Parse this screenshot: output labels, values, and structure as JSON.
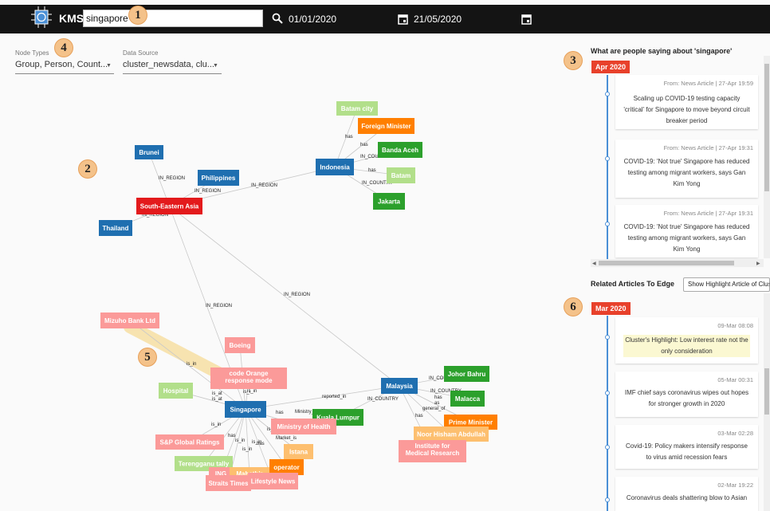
{
  "app": {
    "name": "KMS"
  },
  "header": {
    "search_value": "singapore",
    "date_from": "01/01/2020",
    "date_to": "21/05/2020"
  },
  "badges": [
    "1",
    "2",
    "3",
    "4",
    "5",
    "6"
  ],
  "filters": {
    "node_types_label": "Node Types",
    "node_types_value": "Group, Person, Count...",
    "data_source_label": "Data Source",
    "data_source_value": "cluster_newsdata, clu..."
  },
  "graph": {
    "nodes": [
      {
        "id": "brunei",
        "label": "Brunei",
        "color": "#1f6fb0"
      },
      {
        "id": "philippines",
        "label": "Philippines",
        "color": "#1f6fb0"
      },
      {
        "id": "sea",
        "label": "South-Eastern Asia",
        "color": "#e31a1c"
      },
      {
        "id": "thailand",
        "label": "Thailand",
        "color": "#1f6fb0"
      },
      {
        "id": "indonesia",
        "label": "Indonesia",
        "color": "#1f6fb0"
      },
      {
        "id": "batamcity",
        "label": "Batam city",
        "color": "#b2df8a"
      },
      {
        "id": "foreignmin",
        "label": "Foreign Minister",
        "color": "#ff7f00"
      },
      {
        "id": "bandaaceh",
        "label": "Banda Aceh",
        "color": "#2ca02c"
      },
      {
        "id": "batam",
        "label": "Batam",
        "color": "#b2df8a"
      },
      {
        "id": "jakarta",
        "label": "Jakarta",
        "color": "#2ca02c"
      },
      {
        "id": "mizuho",
        "label": "Mizuho Bank Ltd",
        "color": "#fb9a99"
      },
      {
        "id": "boeing",
        "label": "Boeing",
        "color": "#fb9a99"
      },
      {
        "id": "codeorange",
        "label": "code Orange response mode",
        "color": "#fb9a99"
      },
      {
        "id": "hospital",
        "label": "Hospital",
        "color": "#b2df8a"
      },
      {
        "id": "singapore",
        "label": "Singapore",
        "color": "#1f6fb0"
      },
      {
        "id": "malaysia",
        "label": "Malaysia",
        "color": "#1f6fb0"
      },
      {
        "id": "johor",
        "label": "Johor Bahru",
        "color": "#2ca02c"
      },
      {
        "id": "malacca",
        "label": "Malacca",
        "color": "#2ca02c"
      },
      {
        "id": "primemin",
        "label": "Prime Minister",
        "color": "#ff7f00"
      },
      {
        "id": "noor",
        "label": "Noor Hisham Abdullah",
        "color": "#fdbf6f"
      },
      {
        "id": "imr",
        "label": "Institute for Medical Research",
        "color": "#fb9a99"
      },
      {
        "id": "kl",
        "label": "Kuala Lumpur",
        "color": "#2ca02c"
      },
      {
        "id": "moh",
        "label": "Ministry of Health",
        "color": "#fb9a99"
      },
      {
        "id": "sp",
        "label": "S&P Global Ratings",
        "color": "#fb9a99"
      },
      {
        "id": "terengganu",
        "label": "Terengganu tally",
        "color": "#b2df8a"
      },
      {
        "id": "istana",
        "label": "Istana",
        "color": "#fdbf6f"
      },
      {
        "id": "operator",
        "label": "operator",
        "color": "#ff7f00"
      },
      {
        "id": "ing",
        "label": "ING",
        "color": "#fb9a99"
      },
      {
        "id": "mahathir",
        "label": "Mahathir",
        "color": "#fdbf6f"
      },
      {
        "id": "straits",
        "label": "Straits Times",
        "color": "#fb9a99"
      },
      {
        "id": "lifestyle",
        "label": "Lifestyle News",
        "color": "#fb9a99"
      }
    ],
    "edge_labels": [
      "IN_REGION",
      "IN_REGION",
      "IN_REGION",
      "IN_REGION",
      "IN_REGION",
      "IN_REGION",
      "has",
      "has",
      "IN_COUNTRY",
      "has",
      "IN_COUNTRY",
      "is_in",
      "is_at",
      "is_at",
      "is_in",
      "reported_in",
      "IN_COUNTRY",
      "IN_COUNTRY",
      "IN_COUNTRY",
      "has",
      "as",
      "general_of",
      "has",
      "Ministry_a",
      "has",
      "is_in",
      "has",
      "Market_is",
      "is_in",
      "is_in",
      "is_in",
      "is_in",
      "has",
      "is_i"
    ]
  },
  "right_panel": {
    "people_title": "What are people saying about 'singapore'",
    "people_month": "Apr 2020",
    "people_cards": [
      {
        "meta": "From: News Article | 27-Apr 19:59",
        "text": "Scaling up COVID-19 testing capacity 'critical' for Singapore to move beyond circuit breaker period"
      },
      {
        "meta": "From: News Article | 27-Apr 19:31",
        "text": "COVID-19: 'Not true' Singapore has reduced testing among migrant workers, says Gan Kim Yong"
      },
      {
        "meta": "From: News Article | 27-Apr 19:31",
        "text": "COVID-19: 'Not true' Singapore has reduced testing among migrant workers, says Gan Kim Yong"
      }
    ],
    "related_title": "Related Articles To Edge",
    "highlight_button": "Show Highlight Article of Clust",
    "related_month": "Mar 2020",
    "related_cards": [
      {
        "meta": "09-Mar 08:08",
        "text": "Cluster's Highlight: Low interest rate not the only consideration",
        "highlight": true
      },
      {
        "meta": "05-Mar 00:31",
        "text": "IMF chief says coronavirus wipes out hopes for stronger growth in 2020",
        "highlight": false
      },
      {
        "meta": "03-Mar 02:28",
        "text": "Covid-19: Policy makers intensify response to virus amid recession fears",
        "highlight": false
      },
      {
        "meta": "02-Mar 19:22",
        "text": "Coronavirus deals shattering blow to Asian",
        "highlight": false
      }
    ]
  },
  "colors": {
    "header_bg": "#141414",
    "month_tag": "#e8412b",
    "timeline": "#4a8fd6",
    "badge": "#f4c28a"
  }
}
